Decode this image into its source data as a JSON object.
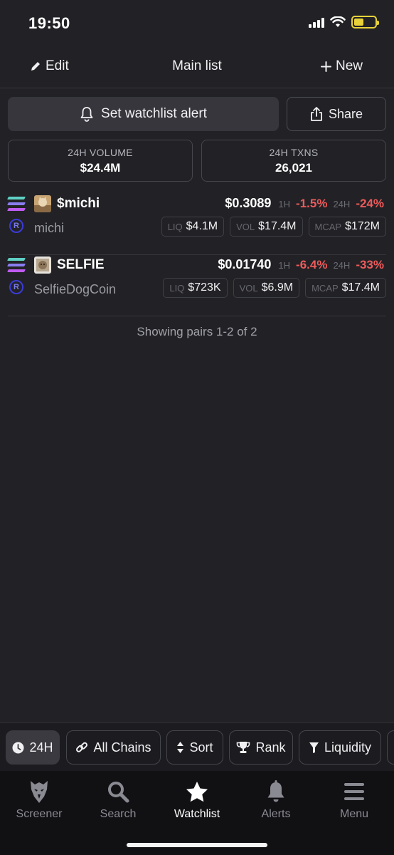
{
  "status_bar": {
    "time": "19:50"
  },
  "header": {
    "edit_label": "Edit",
    "title": "Main list",
    "new_label": "New"
  },
  "actions": {
    "alert_label": "Set watchlist alert",
    "share_label": "Share"
  },
  "stats": [
    {
      "label": "24H VOLUME",
      "value": "$24.4M"
    },
    {
      "label": "24H TXNS",
      "value": "26,021"
    }
  ],
  "pairs": [
    {
      "symbol": "$michi",
      "name": "michi",
      "price": "$0.3089",
      "change_1h_label": "1H",
      "change_1h": "-1.5%",
      "change_24h_label": "24H",
      "change_24h": "-24%",
      "liq_label": "LIQ",
      "liq": "$4.1M",
      "vol_label": "VOL",
      "vol": "$17.4M",
      "mcap_label": "MCAP",
      "mcap": "$172M"
    },
    {
      "symbol": "SELFIE",
      "name": "SelfieDogCoin",
      "price": "$0.01740",
      "change_1h_label": "1H",
      "change_1h": "-6.4%",
      "change_24h_label": "24H",
      "change_24h": "-33%",
      "liq_label": "LIQ",
      "liq": "$723K",
      "vol_label": "VOL",
      "vol": "$6.9M",
      "mcap_label": "MCAP",
      "mcap": "$17.4M"
    }
  ],
  "showing_text": "Showing pairs 1-2 of 2",
  "filters": [
    {
      "label": "24H",
      "icon": "clock-icon"
    },
    {
      "label": "All Chains",
      "icon": "link-icon"
    },
    {
      "label": "Sort",
      "icon": "sort-icon"
    },
    {
      "label": "Rank",
      "icon": "trophy-icon"
    },
    {
      "label": "Liquidity",
      "icon": "filter-icon"
    }
  ],
  "nav": [
    {
      "label": "Screener",
      "icon": "eagle-icon"
    },
    {
      "label": "Search",
      "icon": "search-icon"
    },
    {
      "label": "Watchlist",
      "icon": "star-icon"
    },
    {
      "label": "Alerts",
      "icon": "bell-icon"
    },
    {
      "label": "Menu",
      "icon": "menu-icon"
    }
  ],
  "colors": {
    "negative": "#ee5b5b",
    "background": "#222226"
  }
}
